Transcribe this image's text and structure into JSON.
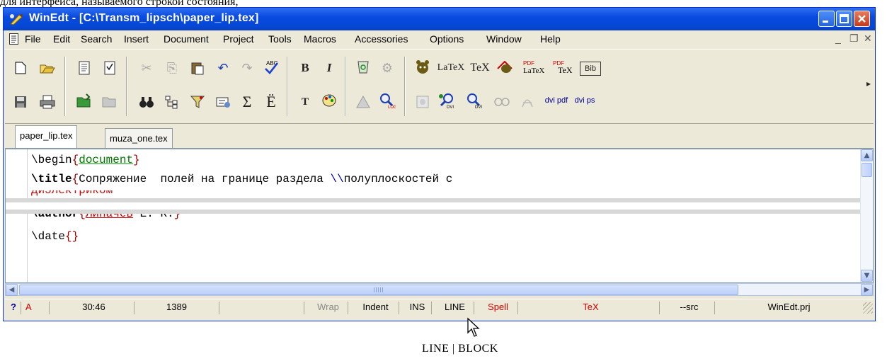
{
  "caption_top": "для интерфейса, называемого строкой состояния,",
  "window": {
    "title": "WinEdt - [C:\\Transm_lipsch\\paper_lip.tex]",
    "colors": {
      "titlebar": "#0a4ae0",
      "close": "#c7391b"
    }
  },
  "menu": [
    "File",
    "Edit",
    "Search",
    "Insert",
    "Document",
    "Project",
    "Tools",
    "Macros",
    "Accessories",
    "Options",
    "Window",
    "Help"
  ],
  "toolbar": {
    "bold_label": "B",
    "italic_label": "I",
    "typewriter_label": "T",
    "sigma_label": "Σ",
    "umlaut_label": "Ë",
    "latex_label": "LaTeX",
    "tex_label": "TeX",
    "bib_label": "Bib",
    "dvi_pdf_label": "dvi pdf",
    "dvi_ps_label": "dvi ps",
    "overflow": "▸"
  },
  "tabs": [
    {
      "label": "paper_lip.tex",
      "active": true
    },
    {
      "label": "muza_one.tex",
      "active": false
    }
  ],
  "editor": {
    "line1_cmd": "\\begin",
    "line1_arg": "document",
    "line2_cmd": "\\title",
    "line2_text": "Сопряжение  полей на границе раздела ",
    "line2_break": "\\\\",
    "line2_text2": "полуплоскостей с",
    "line3_partial": "диэлектриком",
    "line4_cmd": "\\author",
    "line4_arg": "Липачёв",
    "line4_rest": "~Е.~К.",
    "line5_cmd": "\\date",
    "line5_arg": "{}"
  },
  "status": {
    "help": "?",
    "mode": "A",
    "position": "30:46",
    "lines": "1389",
    "wrap": "Wrap",
    "indent": "Indent",
    "ins": "INS",
    "line": "LINE",
    "spell": "Spell",
    "tex": "TeX",
    "src": "--src",
    "project": "WinEdt.prj"
  },
  "caption": "LINE | BLOCK"
}
